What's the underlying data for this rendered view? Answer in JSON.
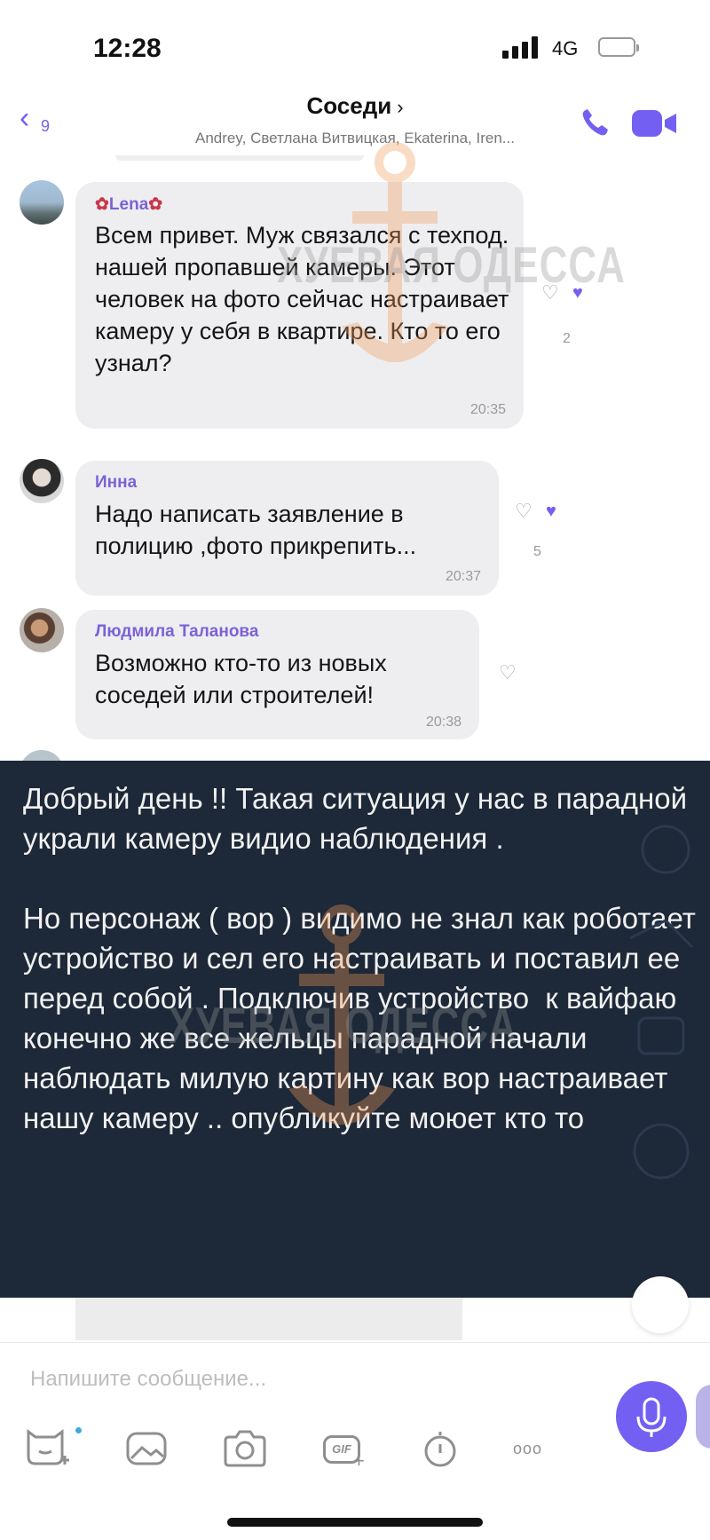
{
  "status_bar": {
    "time": "12:28",
    "network": "4G"
  },
  "header": {
    "back_count": "9",
    "title": "Соседи",
    "members": "Andrey, Светлана Витвицкая, Ekaterina, Iren..."
  },
  "messages": [
    {
      "sender": "Lena",
      "text": "Всем привет. Муж связался с техпод. нашей пропавшей камеры. Этот человек на фото сейчас настраивает камеру у себя в квартире.  Кто то его узнал?",
      "time": "20:35",
      "reaction_count": "2"
    },
    {
      "sender": "Инна",
      "text": "Надо написать заявление в полицию ,фото прикрепить...",
      "time": "20:37",
      "reaction_count": "5"
    },
    {
      "sender": "Людмила Таланова",
      "text": "Возможно кто-то из новых соседей  или строителей!",
      "time": "20:38",
      "reaction_count": ""
    }
  ],
  "overlay_post": {
    "text": "Добрый день !! Такая ситуация у нас в парадной украли камеру видио наблюдения .\n\nНо персонаж ( вор ) видимо не знал как роботает устройство и сел его настраивать и поставил ее перед собой . Подключив устройство  к вайфаю конечно же все жельцы парадной начали наблюдать милую картину как вор настраивает нашу камеру .. опубликуйте моюет кто то"
  },
  "watermark": "ХУЕВАЯ ОДЕССА",
  "composer": {
    "placeholder": "Напишите сообщение...",
    "gif_label": "GIF",
    "more_label": "ooo"
  },
  "colors": {
    "accent": "#7360f2",
    "bubble": "#eeeef0",
    "overlay_bg": "#1d2838"
  }
}
